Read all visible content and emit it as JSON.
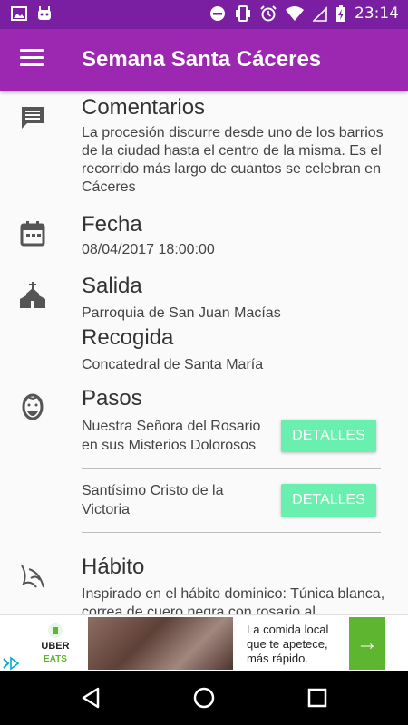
{
  "status_bar": {
    "time": "23:14"
  },
  "app_bar": {
    "title": "Semana Santa Cáceres"
  },
  "comentarios": {
    "heading": "Comentarios",
    "text": "La procesión discurre desde uno de los barrios de la ciudad hasta el centro de la misma. Es el recorrido más largo de cuantos se celebran en Cáceres"
  },
  "fecha": {
    "heading": "Fecha",
    "value": "08/04/2017 18:00:00"
  },
  "salida": {
    "heading": "Salida",
    "value": "Parroquia de San Juan Macías"
  },
  "recogida": {
    "heading": "Recogida",
    "value": "Concatedral de Santa María"
  },
  "pasos": {
    "heading": "Pasos",
    "items": [
      {
        "name": "Nuestra Señora del Rosario en sus Misterios Dolorosos",
        "button": "DETALLES"
      },
      {
        "name": "Santísimo Cristo de la Victoria",
        "button": "DETALLES"
      }
    ]
  },
  "habito": {
    "heading": "Hábito",
    "text": "Inspirado en el hábito dominico: Túnica blanca, correa de cuero negra con rosario al"
  },
  "ad": {
    "brand_top": "UBER",
    "brand_bottom": "EATS",
    "text": "La comida local que te apetece, más rápido.",
    "arrow": "→"
  },
  "colors": {
    "app_bar": "#9c27b0",
    "status_bar": "#7b1fa2",
    "button": "#69f0ae"
  }
}
